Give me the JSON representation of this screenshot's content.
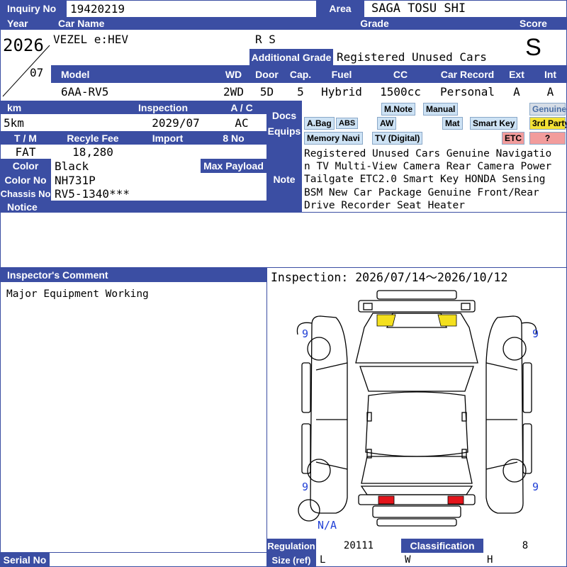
{
  "labels": {
    "inquiry_no": "Inquiry No",
    "area": "Area",
    "year": "Year",
    "car_name": "Car Name",
    "grade": "Grade",
    "score": "Score",
    "additional_grade": "Additional Grade",
    "model": "Model",
    "wd": "WD",
    "door": "Door",
    "cap": "Cap.",
    "fuel": "Fuel",
    "cc": "CC",
    "car_record": "Car Record",
    "ext": "Ext",
    "int": "Int",
    "km": "km",
    "inspection": "Inspection",
    "ac": "A / C",
    "docs_equips": "Docs Equips",
    "tm": "T / M",
    "recycle_fee": "Recyle Fee",
    "import": "Import",
    "eight_no": "8 No",
    "color": "Color",
    "max_payload": "Max Payload",
    "color_no": "Color No",
    "chassis_no": "Chassis No",
    "notice": "Notice",
    "note": "Note",
    "inspectors_comment": "Inspector's Comment",
    "regulation": "Regulation",
    "classification": "Classification",
    "serial_no": "Serial No",
    "size_ref": "Size (ref)"
  },
  "values": {
    "inquiry_no": "19420219",
    "area": "SAGA TOSU SHI",
    "year": "2026",
    "month": "07",
    "car_name": "VEZEL e:HEV",
    "grade": "R S",
    "additional_grade": "Registered Unused Cars",
    "score": "S",
    "model": "6AA-RV5",
    "wd": "2WD",
    "door": "5D",
    "cap": "5",
    "fuel": "Hybrid",
    "cc": "1500cc",
    "car_record": "Personal",
    "ext": "A",
    "int": "A",
    "km": "5km",
    "inspection": "2029/07",
    "ac": "AC",
    "tm": "FAT",
    "recycle_fee": "18,280",
    "import": "",
    "eight_no": "",
    "color": "Black",
    "max_payload": "",
    "color_no": "NH731P",
    "chassis_no": "RV5-1340***",
    "notice": "",
    "note_lines": [
      "Registered Unused Cars Genuine Navigatio",
      "n TV Multi-View Camera Rear Camera Power",
      " Tailgate ETC2.0 Smart Key HONDA Sensing",
      " BSM New Car Package Genuine Front/Rear",
      "Drive Recorder Seat Heater"
    ],
    "inspectors_comment": "Major Equipment Working",
    "inspection_period": "Inspection: 2026/07/14～2026/10/12",
    "regulation": "20111",
    "classification": "8",
    "serial_no": "",
    "size_l": "L",
    "size_w": "W",
    "size_h": "H"
  },
  "equipment_tags": [
    "M.Note",
    "Manual",
    "Genuine",
    "A.Bag",
    "ABS",
    "AW",
    "Mat",
    "Smart Key",
    "3rd Party",
    "Memory Navi",
    "TV (Digital)",
    "ETC",
    "?"
  ],
  "diagram": {
    "tire_marks": [
      "9",
      "9",
      "9",
      "9"
    ],
    "spare_label": "N/A"
  },
  "colors": {
    "header": "#3b4ea3",
    "tag": "#cde2f4",
    "tag_yellow": "#f3e135",
    "tag_pink": "#f29c9c",
    "damage_yellow": "#f4e01e",
    "damage_red": "#e4141b",
    "tire_mark": "#1f3fd6"
  }
}
